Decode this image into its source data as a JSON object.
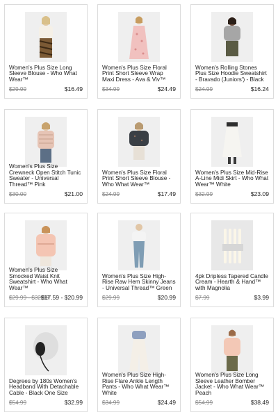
{
  "products": [
    {
      "title": "Women's Plus Size Long Sleeve Blouse - Who What Wear™",
      "old_price": "$29.99",
      "new_price": "$16.49",
      "image": "woman-blouse-leopard-skirt"
    },
    {
      "title": "Women's Plus Size Floral Print Short Sleeve Wrap Maxi Dress - Ava & Viv™",
      "old_price": "$34.99",
      "new_price": "$24.49",
      "image": "woman-pink-floral-dress"
    },
    {
      "title": "Women's Rolling Stones Plus Size Hoodie Sweatshirt - Bravado (Juniors') - Black",
      "old_price": "$24.99",
      "new_price": "$16.24",
      "image": "woman-gray-hoodie"
    },
    {
      "title": "Women's Plus Size Crewneck Open Stitch Tunic Sweater - Universal Thread™ Pink",
      "old_price": "$30.00",
      "new_price": "$21.00",
      "image": "woman-pink-sweater"
    },
    {
      "title": "Women's Plus Size Floral Print Short Sleeve Blouse - Who What Wear™",
      "old_price": "$24.99",
      "new_price": "$17.49",
      "image": "woman-dark-floral-blouse"
    },
    {
      "title": "Women's Plus Size Mid-Rise A-Line Midi Skirt - Who What Wear™ White",
      "old_price": "$32.99",
      "new_price": "$23.09",
      "image": "white-midi-skirt"
    },
    {
      "title": "Women's Plus Size Smocked Waist Knit Sweatshirt - Who What Wear™",
      "old_price": "$29.99 - $32.99",
      "new_price": "$17.59 - $20.99",
      "image": "woman-peach-sweatshirt"
    },
    {
      "title": "Women's Plus Size High-Rise Raw Hem Skinny Jeans - Universal Thread™ Green",
      "old_price": "$29.99",
      "new_price": "$20.99",
      "image": "woman-skinny-jeans"
    },
    {
      "title": "4pk Dripless Tapered Candle Cream - Hearth & Hand™ with Magnolia",
      "old_price": "$7.99",
      "new_price": "$3.99",
      "image": "tapered-candles"
    },
    {
      "title": "Degrees by 180s Women's Headband With Detachable Cable - Black One Size",
      "old_price": "$54.99",
      "new_price": "$32.99",
      "image": "headband-earmuffs"
    },
    {
      "title": "Women's Plus Size High-Rise Flare Ankle Length Pants - Who What Wear™ White",
      "old_price": "$34.99",
      "new_price": "$24.49",
      "image": "woman-white-flare-pants"
    },
    {
      "title": "Women's Plus Size Long Sleeve Leather Bomber Jacket - Who What Wear™ Peach",
      "old_price": "$54.99",
      "new_price": "$38.49",
      "image": "woman-peach-bomber-jacket"
    }
  ]
}
